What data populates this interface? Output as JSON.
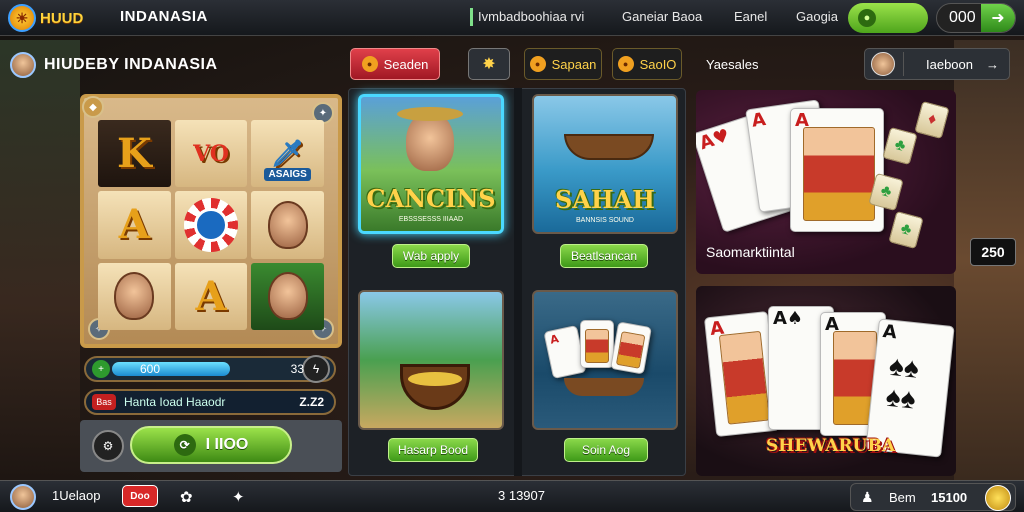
{
  "topbar": {
    "logo_text": "HUUD",
    "title": "INDANASIA",
    "links": [
      "Ivmbadboohiaa  rvi",
      "Ganeiar Baoa",
      "Eanel",
      "Gaogia"
    ],
    "count": "000"
  },
  "left": {
    "player_name": "HIUDEBY INDANASIA",
    "reels": [
      "K",
      "VO",
      "ASAIGS",
      "A",
      "",
      "",
      "",
      "A",
      ""
    ],
    "progress_value": "600",
    "progress_level": "33",
    "progress_fraction": 0.62,
    "info_tag": "Bas",
    "info_label": "Hanta Ioad Haaodr",
    "info_value": "Z.Z2",
    "spin_label": "I IIOO"
  },
  "tabs": {
    "t1": "Seaden",
    "t3": "Sapaan",
    "t4": "SaoIO"
  },
  "games": [
    {
      "title": "CANCINS",
      "sub": "EBSSSESSS IIIAAD",
      "button": "Wab apply"
    },
    {
      "title": "SAHAH",
      "sub": "BANNSIS SOUND",
      "button": "Beatlsancan"
    },
    {
      "title": "",
      "sub": "",
      "button": "Hasarp Bood"
    },
    {
      "title": "",
      "sub": "",
      "button": "Soin Aog"
    }
  ],
  "right": {
    "label": "Yaesales",
    "button": "Iaeboon",
    "card1_label": "Saomarktiintal",
    "card1_score": "250",
    "card2_banner": "SHEWARUBA"
  },
  "bottom": {
    "name": "1Uelaop",
    "badge": "Doo",
    "center": "3 13907",
    "right_label": "Bem",
    "right_value": "15100"
  },
  "colors": {
    "accent_green": "#6fc82e",
    "selected_border": "#4ad8ff",
    "gold": "#ffd24a"
  }
}
